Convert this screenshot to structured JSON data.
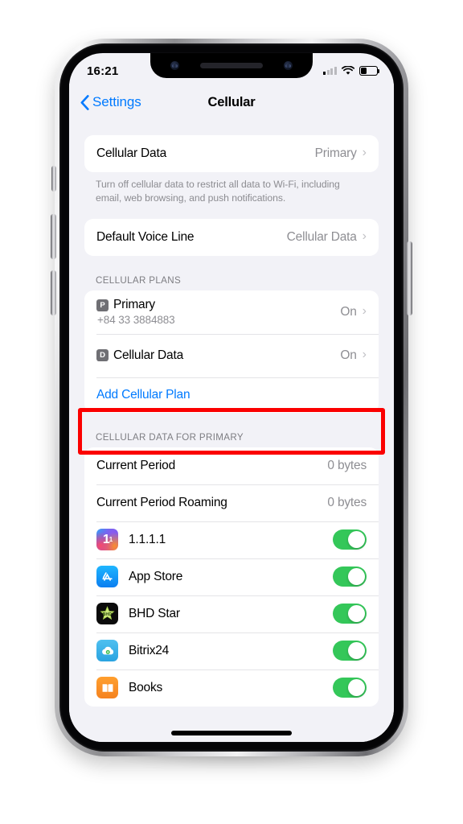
{
  "status_bar": {
    "time": "16:21",
    "signal_icon": "signal-dots-icon",
    "wifi_icon": "wifi-icon",
    "battery_icon": "battery-icon",
    "battery_level_pct": 36
  },
  "nav_bar": {
    "back_label": "Settings",
    "back_icon": "chevron-left-icon",
    "title": "Cellular"
  },
  "section_data": {
    "rows": [
      {
        "label": "Cellular Data",
        "value": "Primary",
        "chevron": "›"
      }
    ],
    "footnote": "Turn off cellular data to restrict all data to Wi-Fi, including email, web browsing, and push notifications."
  },
  "section_voice": {
    "rows": [
      {
        "label": "Default Voice Line",
        "value": "Cellular Data",
        "chevron": "›"
      }
    ]
  },
  "section_plans": {
    "header": "CELLULAR PLANS",
    "plans": [
      {
        "badge": "P",
        "name": "Primary",
        "subtitle": "+84 33 3884883",
        "value": "On",
        "chevron": "›",
        "highlighted": false
      },
      {
        "badge": "D",
        "name": "Cellular Data",
        "subtitle": "",
        "value": "On",
        "chevron": "›",
        "highlighted": true
      }
    ],
    "add_link": "Add Cellular Plan"
  },
  "section_usage": {
    "header": "CELLULAR DATA FOR PRIMARY",
    "usage_rows": [
      {
        "label": "Current Period",
        "value": "0 bytes"
      },
      {
        "label": "Current Period Roaming",
        "value": "0 bytes"
      }
    ],
    "apps": [
      {
        "name": "1.1.1.1",
        "icon": "app-icon-1111",
        "enabled": true
      },
      {
        "name": "App Store",
        "icon": "app-icon-app-store",
        "enabled": true
      },
      {
        "name": "BHD Star",
        "icon": "app-icon-bhd-star",
        "enabled": true
      },
      {
        "name": "Bitrix24",
        "icon": "app-icon-bitrix24",
        "enabled": true
      },
      {
        "name": "Books",
        "icon": "app-icon-books",
        "enabled": true
      }
    ]
  },
  "annotation": {
    "type": "highlight-rectangle",
    "color": "#FB0000",
    "target": "Cellular Data plan row"
  },
  "colors": {
    "accent_blue": "#007AFF",
    "toggle_green": "#34C759",
    "page_background": "#F2F2F7",
    "card_background": "#FFFFFF",
    "secondary_text": "#8E8E93"
  },
  "device": {
    "home_indicator": "home-indicator"
  }
}
